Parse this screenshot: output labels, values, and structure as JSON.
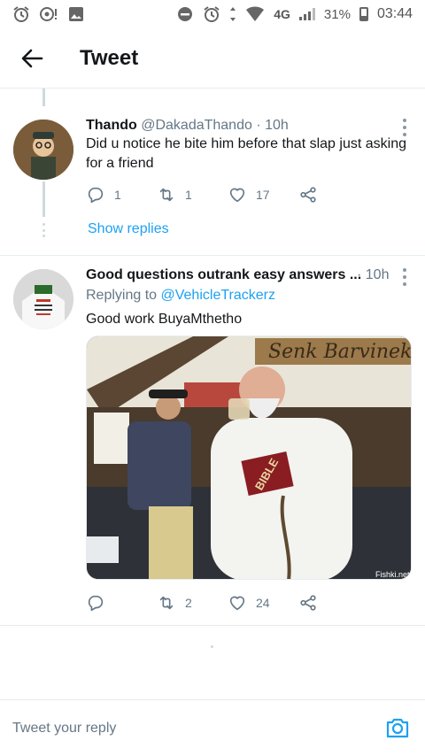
{
  "status_bar": {
    "network": "4G",
    "battery": "31%",
    "time": "03:44"
  },
  "header": {
    "title": "Tweet"
  },
  "tweets": [
    {
      "name": "Thando",
      "handle": "@DakadaThando",
      "time": "· 10h",
      "text": "Did u notice he bite him before that slap just asking for a friend",
      "replies": "1",
      "retweets": "1",
      "likes": "17",
      "show_replies": "Show replies"
    },
    {
      "name": "Good questions outrank easy answers ...",
      "time": "· 10h",
      "replying_label": "Replying to",
      "replying_handle": "@VehicleTrackerz",
      "text": "Good work BuyaMthetho",
      "replies": "",
      "retweets": "2",
      "likes": "24",
      "media": {
        "sign_text": "Senk Barvinek",
        "book_text": "BIBLE",
        "watermark": "Fishki.net"
      }
    }
  ],
  "reply_bar": {
    "placeholder": "Tweet your reply"
  },
  "colors": {
    "accent": "#1da1f2",
    "text": "#14171a",
    "muted": "#657786",
    "border": "#e6ecf0"
  }
}
